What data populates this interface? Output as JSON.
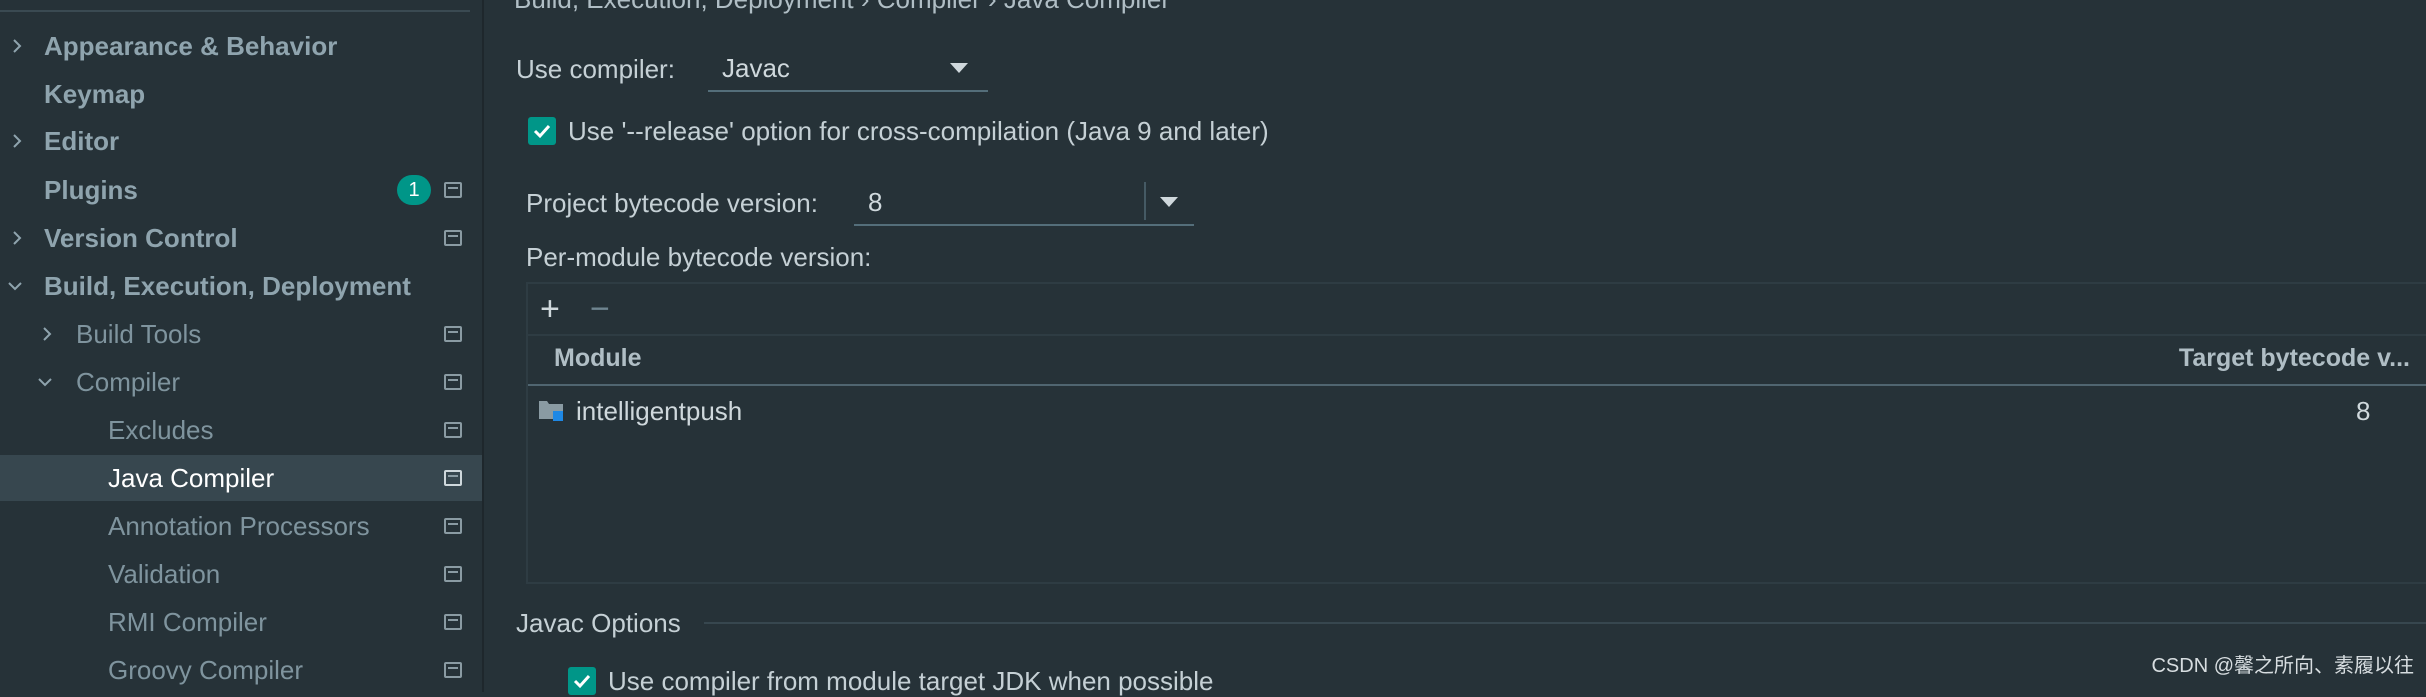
{
  "sidebar": {
    "items": [
      {
        "label": "Appearance & Behavior",
        "chevron": "right"
      },
      {
        "label": "Keymap"
      },
      {
        "label": "Editor",
        "chevron": "right"
      },
      {
        "label": "Plugins",
        "badge": "1"
      },
      {
        "label": "Version Control",
        "chevron": "right"
      },
      {
        "label": "Build, Execution, Deployment",
        "chevron": "down"
      },
      {
        "label": "Build Tools",
        "chevron": "right"
      },
      {
        "label": "Compiler",
        "chevron": "down"
      },
      {
        "label": "Excludes"
      },
      {
        "label": "Java Compiler",
        "selected": true
      },
      {
        "label": "Annotation Processors"
      },
      {
        "label": "Validation"
      },
      {
        "label": "RMI Compiler"
      },
      {
        "label": "Groovy Compiler"
      }
    ]
  },
  "main": {
    "cut_title": "Build, Execution, Deployment › Compiler › Java Compiler",
    "use_compiler_label": "Use compiler:",
    "use_compiler_value": "Javac",
    "release_option_label": "Use '--release' option for cross-compilation (Java 9 and later)",
    "release_option_checked": true,
    "bytecode_label": "Project bytecode version:",
    "bytecode_value": "8",
    "per_module_label": "Per-module bytecode version:",
    "table": {
      "add_label": "+",
      "remove_label": "−",
      "columns": [
        "Module",
        "Target bytecode v..."
      ],
      "rows": [
        {
          "module": "intelligentpush",
          "target": "8"
        }
      ]
    },
    "javac_options_title": "Javac Options",
    "module_jdk_label": "Use compiler from module target JDK when possible",
    "module_jdk_checked": true
  },
  "watermark": "CSDN @馨之所向、素履以往",
  "colors": {
    "background": "#263238",
    "accent": "#009688",
    "selected_row": "#37474f"
  }
}
